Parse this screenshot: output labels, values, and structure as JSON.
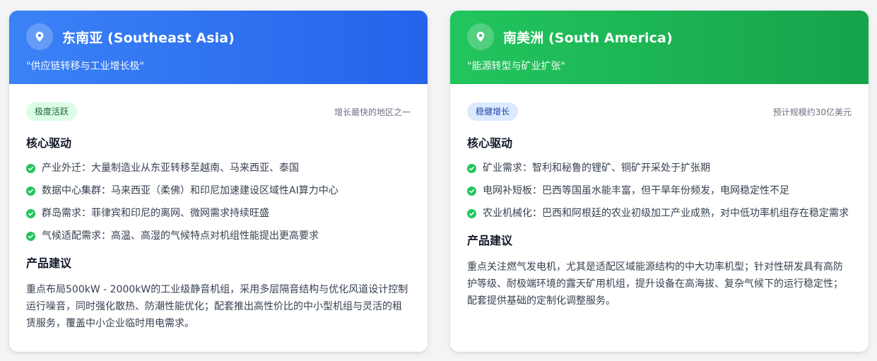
{
  "cards": [
    {
      "region": "东南亚 (Southeast Asia)",
      "tagline": "\"供应链转移与工业增长极\"",
      "badge": "极度活跃",
      "note": "增长最快的地区之一",
      "drivers_title": "核心驱动",
      "drivers": [
        "产业外迁：大量制造业从东亚转移至越南、马来西亚、泰国",
        "数据中心集群：马来西亚（柔佛）和印尼加速建设区域性AI算力中心",
        "群岛需求：菲律宾和印尼的离网、微网需求持续旺盛",
        "气候适配需求：高温、高湿的气候特点对机组性能提出更高要求"
      ],
      "product_title": "产品建议",
      "recommendation": "重点布局500kW - 2000kW的工业级静音机组，采用多层隔音结构与优化风道设计控制运行噪音，同时强化散热、防潮性能优化；配套推出高性价比的中小型机组与灵活的租赁服务，覆盖中小企业临时用电需求。",
      "header_color": "#2563eb",
      "icon": "map-pin-icon"
    },
    {
      "region": "南美洲 (South America)",
      "tagline": "\"能源转型与矿业扩张\"",
      "badge": "稳健增长",
      "note": "预计规模约30亿美元",
      "drivers_title": "核心驱动",
      "drivers": [
        "矿业需求：智利和秘鲁的锂矿、铜矿开采处于扩张期",
        "电网补短板：巴西等国虽水能丰富，但干旱年份频发，电网稳定性不足",
        "农业机械化：巴西和阿根廷的农业初级加工产业成熟，对中低功率机组存在稳定需求"
      ],
      "product_title": "产品建议",
      "recommendation": "重点关注燃气发电机，尤其是适配区域能源结构的中大功率机型；针对性研发具有高防护等级、耐极端环境的露天矿用机组，提升设备在高海拔、复杂气候下的运行稳定性；配套提供基础的定制化调整服务。",
      "header_color": "#16a34a",
      "icon": "map-pin-icon"
    }
  ],
  "check_icon": "check-circle-icon",
  "check_color": "#22c55e"
}
